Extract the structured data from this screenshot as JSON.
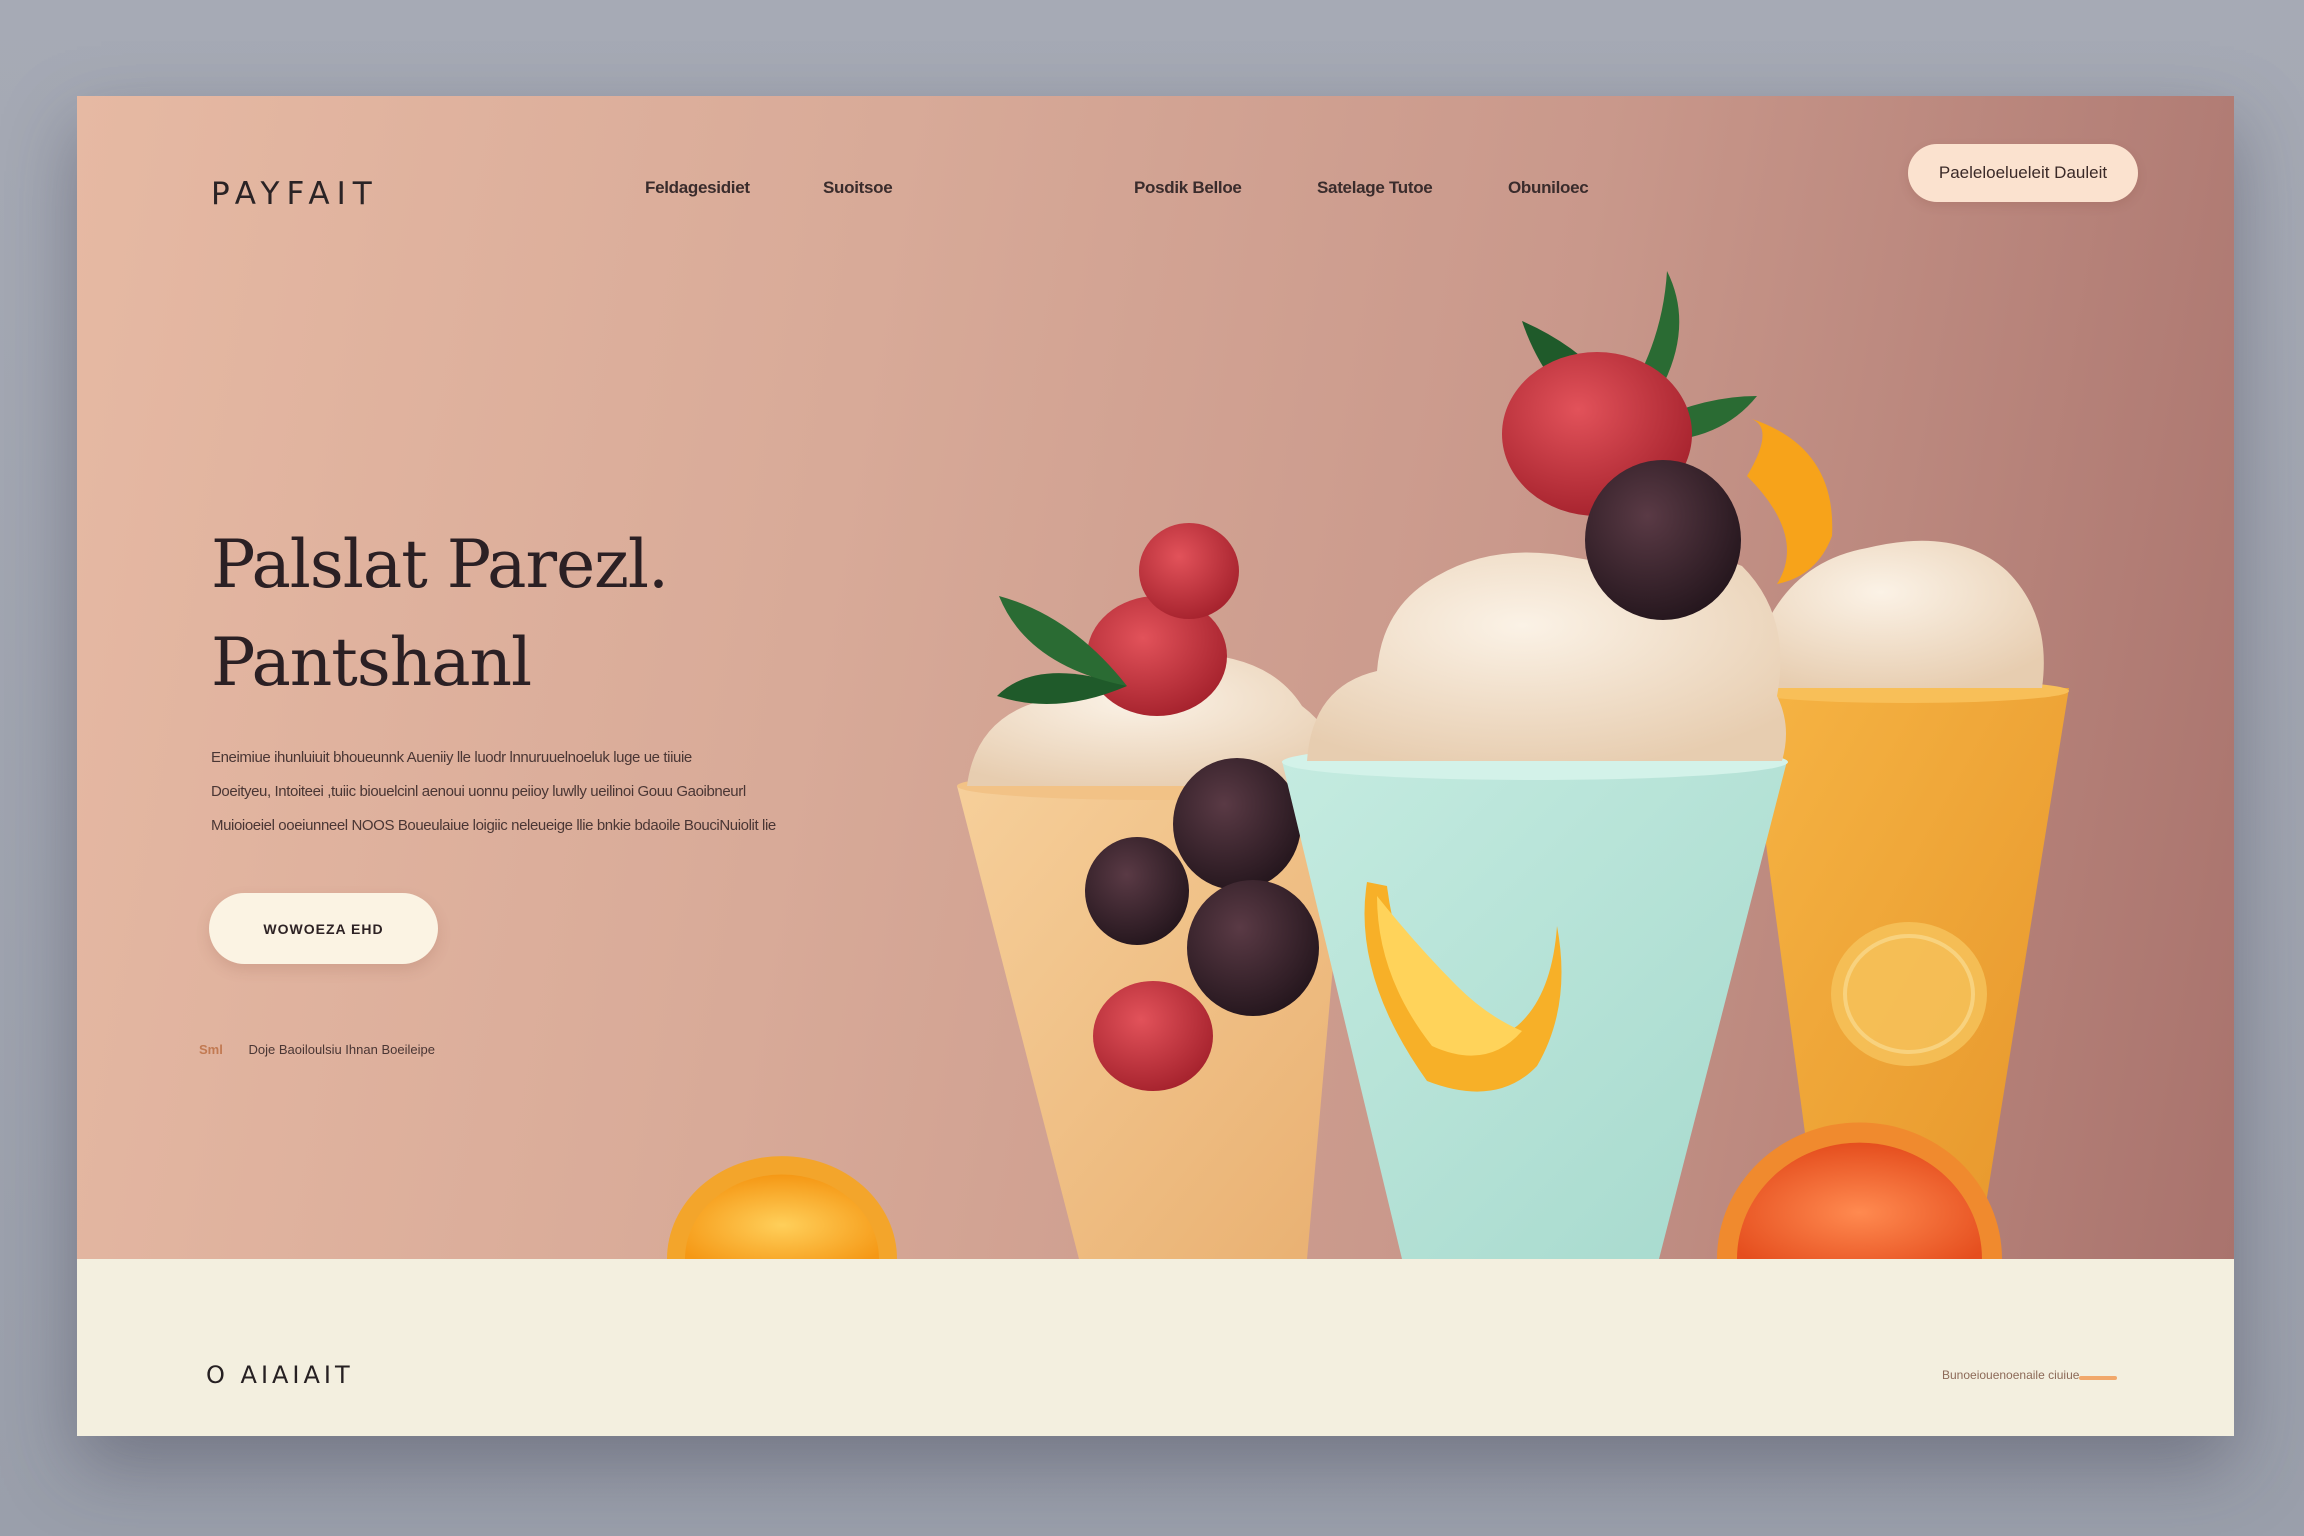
{
  "brand": {
    "logo": "PAYFAIT",
    "footer_logo": "O AIAIAIT"
  },
  "nav": [
    {
      "label": "Feldagesidiet"
    },
    {
      "label": "Suoitsoe"
    },
    {
      "label": "Posdik Belloe"
    },
    {
      "label": "Satelage Tutoe"
    },
    {
      "label": "Obuniloec"
    }
  ],
  "header_cta": "Paeleloelueleit Dauleit",
  "hero": {
    "title_line1": "Palslat Parezl.",
    "title_line2": "Pantshanl",
    "description": [
      "Eneimiue ihunluiuit bhoueunnk Aueniiy lle luodr lnnuruuelnoeluk luge ue tiiuie",
      "Doeityeu, Intoiteei ,tuiic biouelcinl aenoui uonnu peiioy luwlly ueilinoi Gouu Gaoibneurl",
      "Muioioeiel ooeiunneel NOOS Boueulaiue loigiic neleueige llie bnkie bdaoile BouciNuiolit lie"
    ],
    "cta": "WOWOEZA EHD",
    "note_number": "Sml",
    "note_text": "Doje Baoiloulsiu Ihnan Boeileipe"
  },
  "footer": {
    "link": "Bunoeiouenoenaile ciuiue"
  },
  "colors": {
    "hero_bg_left": "#e6b9a3",
    "hero_bg_right": "#a9736d",
    "footer_bg": "#f3efdf",
    "cup_peach": "#f1c48e",
    "cup_mint": "#b8e3d8",
    "cup_yellow": "#f0a93a",
    "orange": "#f7a21d",
    "raspberry": "#c9323b",
    "blackberry": "#3a2630",
    "cream": "#f1e2cf"
  }
}
